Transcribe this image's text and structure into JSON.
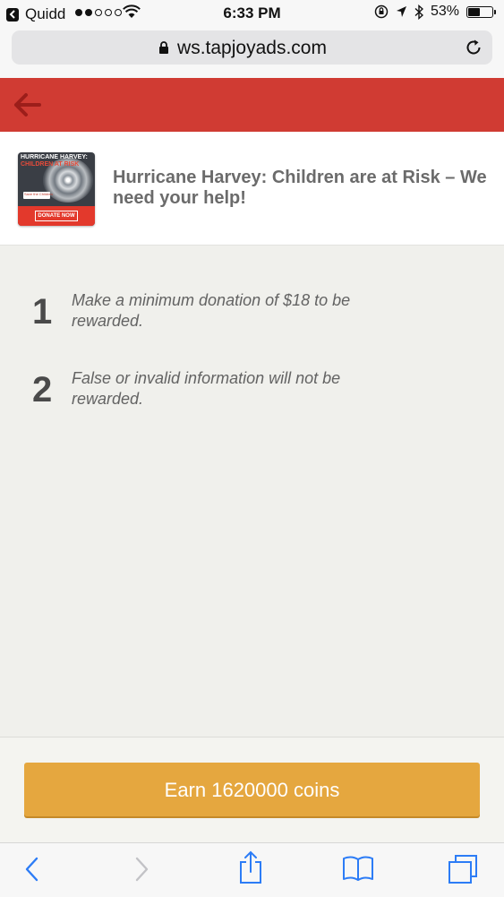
{
  "status_bar": {
    "back_app": "Quidd",
    "time": "6:33 PM",
    "battery": "53%",
    "battery_level": 0.53,
    "signal_bars": [
      true,
      true,
      false,
      false,
      false
    ]
  },
  "browser": {
    "url": "ws.tapjoyads.com"
  },
  "offer": {
    "thumb_line1": "HURRICANE HARVEY:",
    "thumb_line2": "CHILDREN AT RISK",
    "thumb_badge": "Save the Children",
    "thumb_button": "DONATE NOW",
    "title": "Hurricane Harvey: Children are at Risk – We need your help!"
  },
  "steps": [
    {
      "number": "1",
      "text": "Make a minimum donation of $18 to be rewarded."
    },
    {
      "number": "2",
      "text": "False or invalid information will not be rewarded."
    }
  ],
  "cta": {
    "label": "Earn 1620000 coins"
  },
  "colors": {
    "header_red": "#d03b33",
    "cta_orange": "#e5a73f",
    "ios_blue": "#2c7cf6"
  }
}
